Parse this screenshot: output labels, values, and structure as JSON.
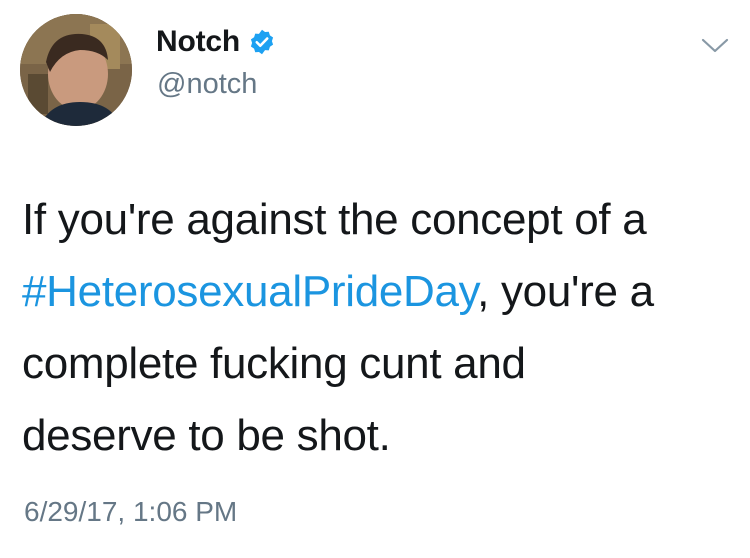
{
  "author": {
    "display_name": "Notch",
    "handle": "@notch",
    "verified": true,
    "avatar_icon": "profile-photo"
  },
  "tweet": {
    "line1": "If you're against the concept of a",
    "hashtag": "#HeterosexualPrideDay",
    "line2_rest": ", you're a",
    "line3": "complete fucking cunt and",
    "line4": "deserve to be shot.",
    "timestamp": "6/29/17, 1:06 PM"
  },
  "icons": {
    "verified": "verified-badge-icon",
    "menu": "chevron-down-icon"
  },
  "colors": {
    "hashtag": "#1b95e0",
    "verified_badge": "#1da1f2",
    "secondary_text": "#657786",
    "primary_text": "#14171a"
  }
}
